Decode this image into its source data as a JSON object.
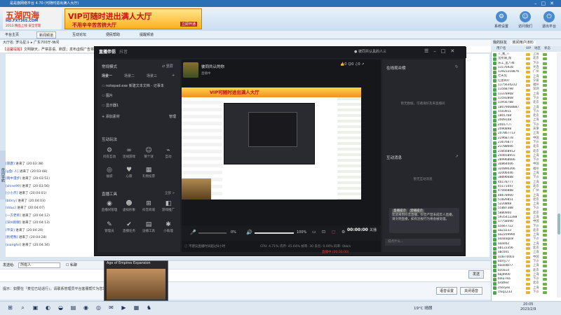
{
  "host": {
    "title": "是是旗网络平台 4.70 (可随时进出满人大厅)",
    "logo_line1": "五湖四海",
    "logo_line2": "HD.FXT365.COM",
    "logo_line3": "2013 精品上线 安全可靠",
    "ad_line1": "VIP可随时进出满人大厅",
    "ad_line2": "不用辛辛苦苦挤大厅",
    "ad_badge": "立即开通",
    "topbuttons": [
      {
        "label": "系统设置",
        "icon": "⚙"
      },
      {
        "label": "访问我们",
        "icon": "☺"
      },
      {
        "label": "退出平台",
        "icon": "⏻"
      }
    ],
    "toolbar": [
      "平台主页",
      "新闻频道",
      "互动论坛",
      "便民帮助",
      "提醒频道"
    ],
    "subtabs": "大厅名: 罗马星斗  ▸  广东700厅-休闲",
    "notice_tag": "【温馨提醒】",
    "notice_text": "文明聊天，严禁恶语、刷屏；发布虚假广告将被踢出房间。",
    "left_strip": "房间导航",
    "chat": [
      {
        "name": "[雷霆]",
        "text": "进来了 (20:03:38)"
      },
      {
        "name": "[g鱼l 人]",
        "text": "进来了 (20:03:48)"
      },
      {
        "name": "[雨中漫步]",
        "text": "进来了 (20:03:51)"
      },
      {
        "name": "[shine99]",
        "text": "进来了 (20:03:56)"
      },
      {
        "name": "[小小杰]",
        "text": "进来了 (20:04:01)"
      },
      {
        "name": "[b0rry]",
        "text": "进来了 (20:04:03)"
      },
      {
        "name": "[dduc]",
        "text": "进来了 (20:04:07)"
      },
      {
        "name": "[一方老师]",
        "text": "进来了 (20:04:12)"
      },
      {
        "name": "[深州刚刚]",
        "text": "进来了 (20:04:13)"
      },
      {
        "name": "[平安]",
        "text": "进来了 (20:04:20)"
      },
      {
        "name": "[别把我]",
        "text": "进来了 (20:04:28)"
      },
      {
        "name": "[xiangfei]",
        "text": "进来了 (20:04:34)"
      }
    ],
    "input_label": "发送给:",
    "input_target": "所有人",
    "private_label": "私聊",
    "send_label": "发送",
    "bottom_tip": "提示：如要在『麦位已站话行』，请联系管理员平台客服帮忙为您站麦。",
    "speech_settings": "语音设置",
    "close_speech": "关闭语音"
  },
  "userpanel": {
    "tabs": [
      "我的好友",
      "房间用户(88)"
    ],
    "headers": [
      "用户名",
      "VIP",
      "地区",
      "状态"
    ],
    "users": [
      {
        "name": "☆_我_☆",
        "loc": "上海"
      },
      {
        "name": "无所谓_帮",
        "loc": "北京"
      },
      {
        "name": "乐工_乱八样",
        "loc": "下沙"
      },
      {
        "name": "13176928",
        "loc": "大连"
      },
      {
        "name": "13923318876",
        "loc": "广州"
      },
      {
        "name": "七天见",
        "loc": "上海"
      },
      {
        "name": "亿思007",
        "loc": "宁波"
      },
      {
        "name": "1175634222",
        "loc": "福州"
      },
      {
        "name": "13568798",
        "loc": "深圳"
      },
      {
        "name": "13378968",
        "loc": "上海"
      },
      {
        "name": "13592868",
        "loc": "下沙"
      },
      {
        "name": "13956788",
        "loc": "北京"
      },
      {
        "name": "18079068887",
        "loc": "上海"
      },
      {
        "name": "1503911",
        "loc": "下沙"
      },
      {
        "name": "1801768",
        "loc": "北京"
      },
      {
        "name": "2009108",
        "loc": "上海"
      },
      {
        "name": "2001八八",
        "loc": "下沙"
      },
      {
        "name": "2090898",
        "loc": "天津"
      },
      {
        "name": "207867713",
        "loc": "上海"
      },
      {
        "name": "22968778",
        "loc": "中国"
      },
      {
        "name": "23676877",
        "loc": "下沙"
      },
      {
        "name": "23788666",
        "loc": "北京"
      },
      {
        "name": "238568912",
        "loc": "北京"
      },
      {
        "name": "244658955",
        "loc": "上海"
      },
      {
        "name": "289968666",
        "loc": "下沙"
      },
      {
        "name": "30864006",
        "loc": "中国"
      },
      {
        "name": "320890266",
        "loc": "福州"
      },
      {
        "name": "32006446",
        "loc": "上海"
      },
      {
        "name": "38896688",
        "loc": "下沙"
      },
      {
        "name": "40178777",
        "loc": "上海"
      },
      {
        "name": "45171447",
        "loc": "北京"
      },
      {
        "name": "47066888",
        "loc": "广州"
      },
      {
        "name": "48678900",
        "loc": "上海"
      },
      {
        "name": "51826851",
        "loc": "北京"
      },
      {
        "name": "5220868",
        "loc": "上海"
      },
      {
        "name": "55887388",
        "loc": "下沙"
      },
      {
        "name": "5880900",
        "loc": "北京"
      },
      {
        "name": "5935412288",
        "loc": "上海"
      },
      {
        "name": "57758090",
        "loc": "中国"
      },
      {
        "name": "a5667722",
        "loc": "下沙"
      },
      {
        "name": "aa23233",
        "loc": "北京"
      },
      {
        "name": "aa2209990",
        "loc": "上海"
      },
      {
        "name": "aaaaaqoal",
        "loc": "下沙"
      },
      {
        "name": "aaa002",
        "loc": "上海"
      },
      {
        "name": "ab122356",
        "loc": "北京"
      },
      {
        "name": "abc001",
        "loc": "上海"
      },
      {
        "name": "ssde70003",
        "loc": "中国"
      },
      {
        "name": "b0rry77",
        "loc": "下沙"
      },
      {
        "name": "baoli8877",
        "loc": "上海"
      },
      {
        "name": "bc0a1d",
        "loc": "北京"
      },
      {
        "name": "bbj9900",
        "loc": "上海"
      },
      {
        "name": "bleu-rea",
        "loc": "下沙"
      },
      {
        "name": "brother",
        "loc": "北京"
      },
      {
        "name": "cheryeo",
        "loc": "上海"
      },
      {
        "name": "chiq1233",
        "loc": "下沙"
      }
    ]
  },
  "stream": {
    "brand": "直播伴侣",
    "version": "抖音",
    "user": "彼同共认具的人三",
    "mode_label": "常规模式",
    "landscape_label": "竖屏",
    "scenes": [
      "场景一",
      "场景二",
      "场景三"
    ],
    "sources": [
      {
        "icon": "▭",
        "label": "notepad.exe 新建文本文档 - 记事本"
      },
      {
        "icon": "▭",
        "label": "图片"
      },
      {
        "icon": "▭",
        "label": "显示器1"
      }
    ],
    "add_source": "添加素材",
    "manage": "管理",
    "interact_title": "互动玩法",
    "interact_tools": [
      {
        "g": "⚙",
        "label": "问答互动"
      },
      {
        "g": "∞",
        "label": "连线游戏"
      },
      {
        "g": "☺",
        "label": "猜个谜"
      },
      {
        "g": "⌁",
        "label": "互动"
      },
      {
        "g": "◎",
        "label": "福袋"
      },
      {
        "g": "♥",
        "label": "心愿"
      },
      {
        "g": "▦",
        "label": "礼物投票"
      }
    ],
    "live_tools_title": "直播工具",
    "all_label": "全部 >",
    "live_tools": [
      {
        "g": "◉",
        "label": "直播间管理"
      },
      {
        "g": "☻",
        "label": "虚拟形象"
      },
      {
        "g": "⊞",
        "label": "抖音商城"
      },
      {
        "g": "◧",
        "label": "游戏推广"
      },
      {
        "g": "✎",
        "label": "管理员"
      },
      {
        "g": "✔",
        "label": "直播任务"
      },
      {
        "g": "▤",
        "label": "边播工具"
      },
      {
        "g": "✱",
        "label": "小助理"
      }
    ],
    "room_title": "彼同共认的你",
    "room_sub": "直播中",
    "stats": "👍0  ☺0  ♫0  ↗",
    "volume_left": "0%",
    "volume_right": "100%",
    "timer": "00:00:00",
    "end_label": "关播",
    "foot_hint": "不建议直播时间超过8小时",
    "foot_stats": "CPU: 4.71%   内存: 45.64%   帧率: 30   丢包: 0.00%   码率: 0kb/s",
    "foot_red": "直播中 (00:00:00)",
    "right_title1": "在线观众榜",
    "right_empty1": "暂无数据，可邀请好友来直播间",
    "right_title2": "互动消息",
    "right_empty2": "暂无互动消息",
    "tip_tags": [
      "直播提示",
      "禁播提示"
    ],
    "tip_text": "欢迎来到抖音直播，抖音严禁未成年人直播，请文明直播，如有违规行为将会被处理。",
    "chat_placeholder": "说点什么..."
  },
  "popup": {
    "title": "Age of Empires Expansion"
  },
  "taskbar": {
    "icons": [
      "⊞",
      "⌕",
      "▣",
      "◐",
      "◒",
      "▤",
      "◉",
      "◎",
      "✉",
      "▶",
      "▦",
      "♞"
    ],
    "weather": "19°C 晴朗",
    "time": "20:05",
    "date": "2023/2/9"
  }
}
